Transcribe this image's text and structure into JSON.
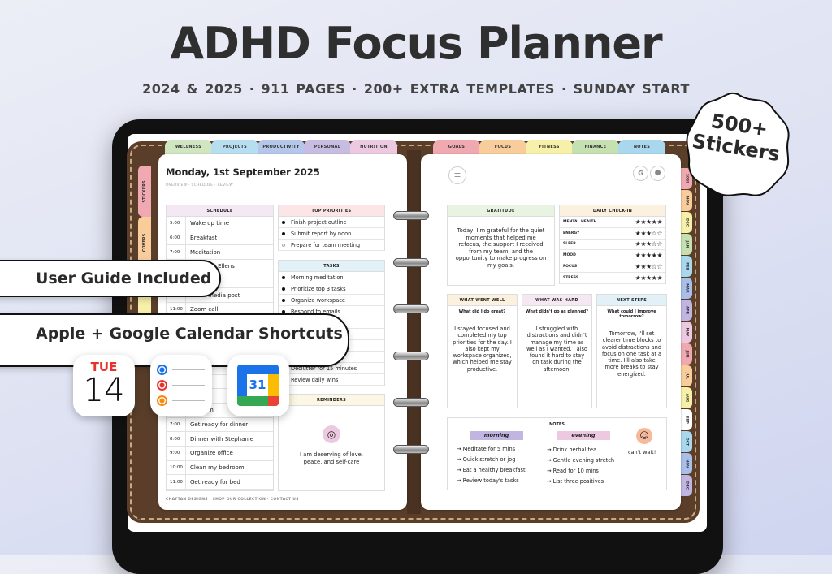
{
  "hero": {
    "title": "ADHD Focus Planner",
    "subtitle": "2024 & 2025  ·  911 PAGES  ·  200+ EXTRA TEMPLATES  ·  SUNDAY START",
    "badge_line1": "500+",
    "badge_line2": "Stickers",
    "pill_guide": "User Guide Included",
    "pill_calendar": "Apple + Google Calendar Shortcuts"
  },
  "apps": {
    "calendar_day": "TUE",
    "calendar_date": "14",
    "gcal_date": "31",
    "reminder_colors": [
      "#1a73e8",
      "#e8322d",
      "#f7890c"
    ]
  },
  "top_tabs_left": [
    {
      "label": "WELLNESS",
      "color": "#cfe6c0"
    },
    {
      "label": "PROJECTS",
      "color": "#b6def0"
    },
    {
      "label": "PRODUCTIVITY",
      "color": "#b4c7ea"
    },
    {
      "label": "PERSONAL",
      "color": "#c7bde3"
    },
    {
      "label": "NUTRITION",
      "color": "#ecc9e0"
    }
  ],
  "top_tabs_right": [
    {
      "label": "GOALS",
      "color": "#f1a9b1"
    },
    {
      "label": "FOCUS",
      "color": "#f9cc9c"
    },
    {
      "label": "FITNESS",
      "color": "#f6f0a8"
    },
    {
      "label": "FINANCE",
      "color": "#c5e1b2"
    },
    {
      "label": "NOTES",
      "color": "#a9d8ee"
    }
  ],
  "side_tabs_left": [
    {
      "label": "STICKERS",
      "color": "#f1a9b1"
    },
    {
      "label": "COVERS",
      "color": "#f9cc9c"
    },
    {
      "label": "",
      "color": "#f6f0a8"
    }
  ],
  "month_tabs": [
    {
      "label": "2025",
      "color": "#f1a9b1"
    },
    {
      "label": "NOV",
      "color": "#f9cc9c"
    },
    {
      "label": "DEC",
      "color": "#f6f0a8"
    },
    {
      "label": "JAN",
      "color": "#c5e1b2"
    },
    {
      "label": "FEB",
      "color": "#a9d8ee"
    },
    {
      "label": "MAR",
      "color": "#a9bfe9"
    },
    {
      "label": "APR",
      "color": "#c1b6e2"
    },
    {
      "label": "MAY",
      "color": "#ecc9e0"
    },
    {
      "label": "JUN",
      "color": "#f1a9b1"
    },
    {
      "label": "JUL",
      "color": "#f9cc9c"
    },
    {
      "label": "AUG",
      "color": "#f6f0a8"
    },
    {
      "label": "SEP",
      "color": "#ffffff"
    },
    {
      "label": "OCT",
      "color": "#a9d8ee"
    },
    {
      "label": "NOV",
      "color": "#a9bfe9"
    },
    {
      "label": "DEC",
      "color": "#c1b6e2"
    }
  ],
  "left_page": {
    "date_title": "Monday, 1st September 2025",
    "nav": "OVERVIEW · SCHEDULE · REVIEW",
    "schedule": {
      "header": "SCHEDULE",
      "rows": [
        {
          "time": "5:00",
          "text": "Wake up time"
        },
        {
          "time": "6:00",
          "text": "Breakfast"
        },
        {
          "time": "7:00",
          "text": "Meditation"
        },
        {
          "time": "",
          "text": "Coffee at Ellens"
        },
        {
          "time": "",
          "text": "up"
        },
        {
          "time": "",
          "text": "social media post"
        },
        {
          "time": "11:00",
          "text": "Zoom call"
        },
        {
          "time": "",
          "text": ""
        },
        {
          "time": "",
          "text": ""
        },
        {
          "time": "",
          "text": ""
        },
        {
          "time": "",
          "text": "on p"
        },
        {
          "time": "",
          "text": "r Gree"
        },
        {
          "time": "",
          "text": "e dog"
        },
        {
          "time": "",
          "text": "es - rem"
        },
        {
          "time": "7:00",
          "text": "Get ready for dinner"
        },
        {
          "time": "8:00",
          "text": "Dinner with Stephanie"
        },
        {
          "time": "9:00",
          "text": "Organize office"
        },
        {
          "time": "10:00",
          "text": "Clean my bedroom"
        },
        {
          "time": "11:00",
          "text": "Get ready for bed"
        }
      ]
    },
    "priorities": {
      "header": "TOP PRIORITIES",
      "items": [
        {
          "text": "Finish project outline",
          "done": true
        },
        {
          "text": "Submit report by noon",
          "done": true
        },
        {
          "text": "Prepare for team meeting",
          "done": false
        }
      ]
    },
    "tasks": {
      "header": "TASKS",
      "items": [
        "Morning meditation",
        "Prioritize top 3 tasks",
        "Organize workspace",
        "Respond to emails",
        "break",
        "",
        "",
        "asks",
        "Declutter for 15 minutes",
        "Review daily wins"
      ]
    },
    "reminders": {
      "header": "REMINDERS",
      "text": "I am deserving of love, peace, and self-care",
      "icon": "target-icon"
    },
    "footer": "CHATTAN DESIGNS  ·  SHOP OUR COLLECTION  ·  CONTACT US"
  },
  "right_page": {
    "gratitude": {
      "header": "GRATITUDE",
      "text": "Today, I'm grateful for the quiet moments that helped me refocus, the support I received from my team, and the opportunity to make progress on my goals."
    },
    "checkin": {
      "header": "DAILY CHECK-IN",
      "rows": [
        {
          "label": "MENTAL HEALTH",
          "rating": 5
        },
        {
          "label": "ENERGY",
          "rating": 3
        },
        {
          "label": "SLEEP",
          "rating": 3
        },
        {
          "label": "MOOD",
          "rating": 5
        },
        {
          "label": "FOCUS",
          "rating": 3
        },
        {
          "label": "STRESS",
          "rating": 5
        }
      ]
    },
    "cards": [
      {
        "header": "WHAT WENT WELL",
        "question": "What did I do great?",
        "answer": "I stayed focused and completed my top priorities for the day. I also kept my workspace organized, which helped me stay productive.",
        "color": "#fbf1de"
      },
      {
        "header": "WHAT WAS HARD",
        "question": "What didn't go as planned?",
        "answer": "I struggled with distractions and didn't manage my time as well as I wanted. I also found it hard to stay on task during the afternoon.",
        "color": "#f6e8f2"
      },
      {
        "header": "NEXT STEPS",
        "question": "What could I improve tomorrow?",
        "answer": "Tomorrow, I'll set clearer time blocks to avoid distractions and focus on one task at a time. I'll also take more breaks to stay energized.",
        "color": "#e2f0f8"
      }
    ],
    "notes": {
      "header": "NOTES",
      "morning_label": "morning",
      "evening_label": "evening",
      "morning": [
        "Meditate for 5 mins",
        "Quick stretch or jog",
        "Eat a healthy breakfast",
        "Review today's tasks"
      ],
      "evening": [
        "Drink herbal tea",
        "Gentle evening stretch",
        "Read for 10 mins",
        "List three positives"
      ],
      "sticker_caption": "can't wait!"
    },
    "icons": {
      "menu": "menu-icon",
      "google": "G",
      "apple": "apple-icon"
    }
  }
}
